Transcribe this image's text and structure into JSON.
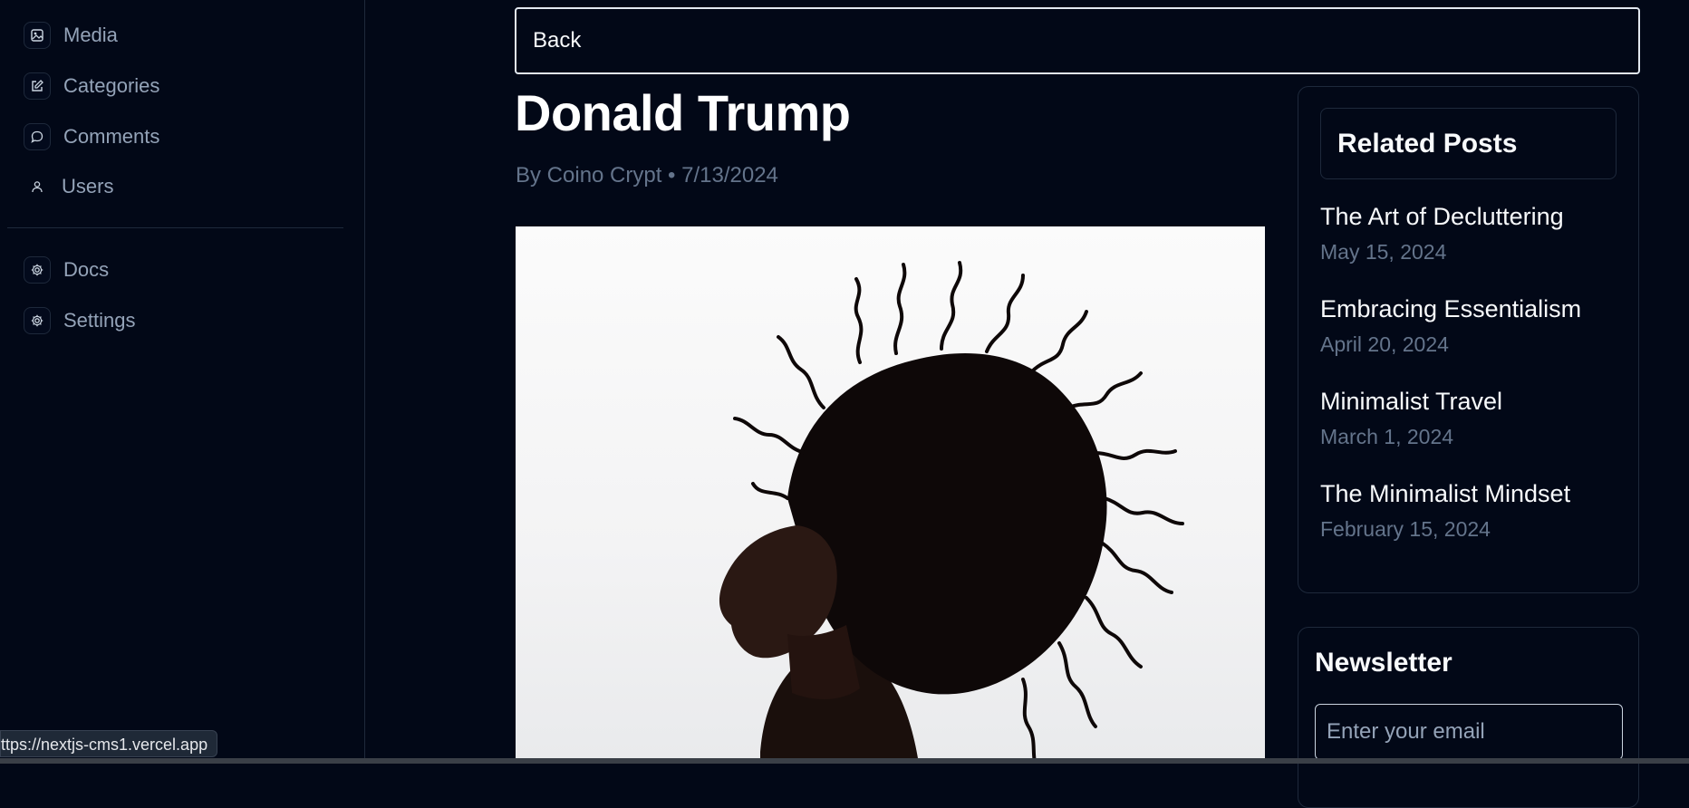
{
  "sidebar": {
    "items": [
      {
        "label": "Media",
        "icon": "media-icon"
      },
      {
        "label": "Categories",
        "icon": "edit-icon"
      },
      {
        "label": "Comments",
        "icon": "comment-icon"
      },
      {
        "label": "Users",
        "icon": "user-icon"
      }
    ],
    "secondary": [
      {
        "label": "Docs",
        "icon": "gear-icon"
      },
      {
        "label": "Settings",
        "icon": "gear-icon"
      }
    ]
  },
  "post": {
    "back_label": "Back",
    "title": "Donald Trump",
    "meta": "By Coino Crypt • 7/13/2024"
  },
  "related": {
    "heading": "Related Posts",
    "items": [
      {
        "title": "The Art of Decluttering",
        "date": "May 15, 2024"
      },
      {
        "title": "Embracing Essentialism",
        "date": "April 20, 2024"
      },
      {
        "title": "Minimalist Travel",
        "date": "March 1, 2024"
      },
      {
        "title": "The Minimalist Mindset",
        "date": "February 15, 2024"
      }
    ]
  },
  "newsletter": {
    "heading": "Newsletter",
    "placeholder": "Enter your email"
  },
  "status_bar": {
    "url": "ttps://nextjs-cms1.vercel.app"
  },
  "colors": {
    "background": "#020817",
    "border": "#1e293b",
    "muted": "#64748b"
  }
}
